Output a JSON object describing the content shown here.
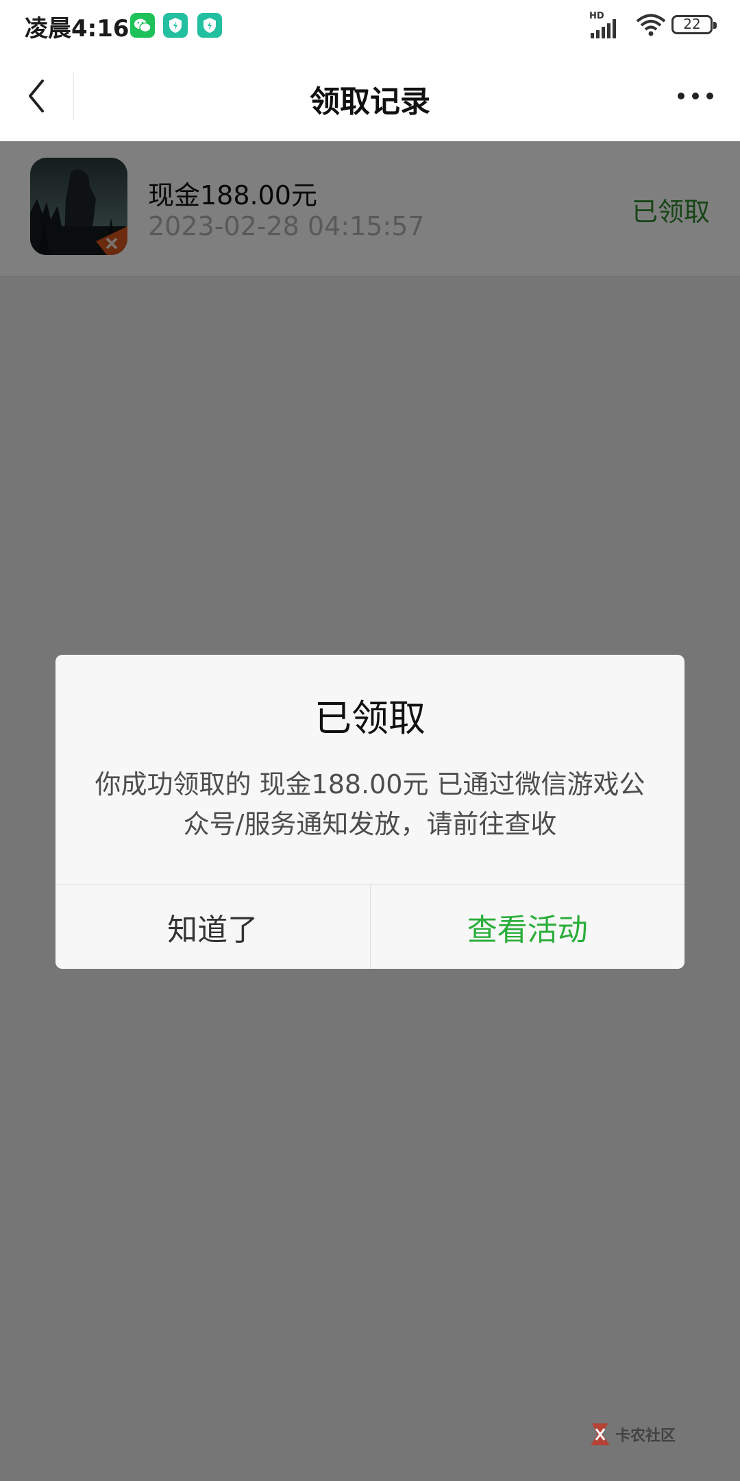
{
  "status_bar": {
    "time": "凌晨4:16",
    "network": "HD",
    "battery": "22",
    "notification_icons": [
      "wechat-icon",
      "shield-app-icon",
      "shield-app-icon"
    ]
  },
  "navbar": {
    "title": "领取记录",
    "back_icon": "chevron-left-icon",
    "more_icon": "more-dots-icon"
  },
  "records": [
    {
      "title": "现金188.00元",
      "time": "2023-02-28 04:15:57",
      "status": "已领取",
      "icon": "game-icon"
    }
  ],
  "dialog": {
    "title": "已领取",
    "message": "你成功领取的 现金188.00元 已通过微信游戏公众号/服务通知发放，请前往查收",
    "ok_label": "知道了",
    "view_label": "查看活动"
  },
  "watermark": {
    "text": "卡农社区"
  },
  "colors": {
    "accent_green": "#2aae3a",
    "status_green": "#2e8b2e"
  }
}
